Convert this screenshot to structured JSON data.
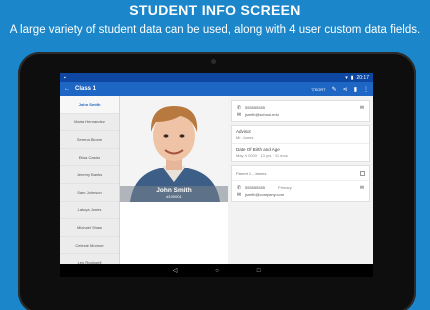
{
  "banner": {
    "title": "STUDENT INFO SCREEN",
    "subtitle": "A large variety of student data can be used, along with 4 user custom data fields."
  },
  "statusbar": {
    "time": "20:17",
    "battery_icon": "battery-icon",
    "signal_icon": "wifi-icon"
  },
  "appbar": {
    "title": "Class 1",
    "back_icon": "arrow-left-icon",
    "sort_label": "SORT",
    "actions": [
      "filter-icon",
      "edit-icon",
      "share-icon",
      "delete-icon",
      "more-icon"
    ]
  },
  "sidebar": {
    "items": [
      {
        "label": "John Smith",
        "active": true
      },
      {
        "label": "Maria Hernandez",
        "active": false
      },
      {
        "label": "Serena Bloom",
        "active": false
      },
      {
        "label": "Elisa Castro",
        "active": false
      },
      {
        "label": "Jeremy Banks",
        "active": false
      },
      {
        "label": "Sam Johnson",
        "active": false
      },
      {
        "label": "Latoya Jones",
        "active": false
      },
      {
        "label": "Michael Shaw",
        "active": false
      },
      {
        "label": "Celeste Monroe",
        "active": false
      },
      {
        "label": "Leo Rockwell",
        "active": false
      }
    ]
  },
  "student": {
    "name": "John Smith",
    "id": "#100001",
    "phone": "555555555",
    "email": "jsmith@school.edu",
    "advisor_label": "Advisor",
    "advisor_value": "Mr. Jones",
    "dob_label": "Date Of Birth and Age",
    "dob_value": "May 4 2003 · 13 yrs · 11 mos"
  },
  "parent": {
    "heading": "Parent 1 - James",
    "phone": "555555555",
    "phone_type": "Primary",
    "email": "jsmith@company.com"
  },
  "navbar": {
    "back": "◁",
    "home": "○",
    "recents": "□"
  },
  "colors": {
    "accent": "#1e66c4",
    "banner": "#1b86c9",
    "statusbar": "#0d47a1"
  }
}
